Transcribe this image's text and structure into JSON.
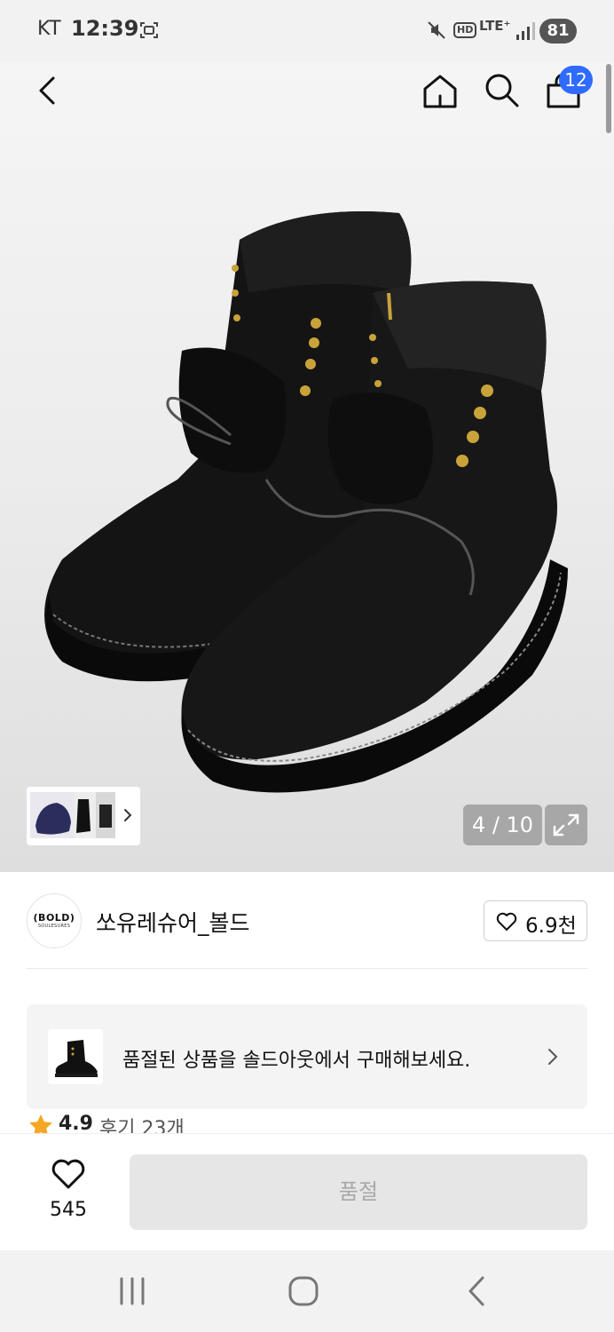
{
  "status_bar": {
    "carrier": "KT",
    "time": "12:39",
    "hd_label": "HD",
    "network": "LTE⁺",
    "battery": "81"
  },
  "top_nav": {
    "cart_count": "12"
  },
  "gallery": {
    "page_indicator": "4 / 10",
    "current_page": 4,
    "total_pages": 10
  },
  "brand": {
    "logo_text": "(BOLD)",
    "logo_subtext": "SOULESURES",
    "name": "쏘유레슈어_볼드",
    "like_count": "6.9천"
  },
  "soldout_banner": {
    "text": "품절된 상품을 솔드아웃에서 구매해보세요."
  },
  "rating": {
    "score": "4.9",
    "reviews": "후기 23개"
  },
  "bottom_bar": {
    "wish_count": "545",
    "button_label": "품절"
  },
  "colors": {
    "cart_badge": "#2f6bff",
    "star": "#f5a623",
    "disabled_button": "#e6e6e6"
  },
  "icons": [
    "back-icon",
    "home-icon",
    "search-icon",
    "shopping-bag-icon",
    "expand-icon",
    "heart-icon",
    "star-icon",
    "chevron-right-icon"
  ]
}
